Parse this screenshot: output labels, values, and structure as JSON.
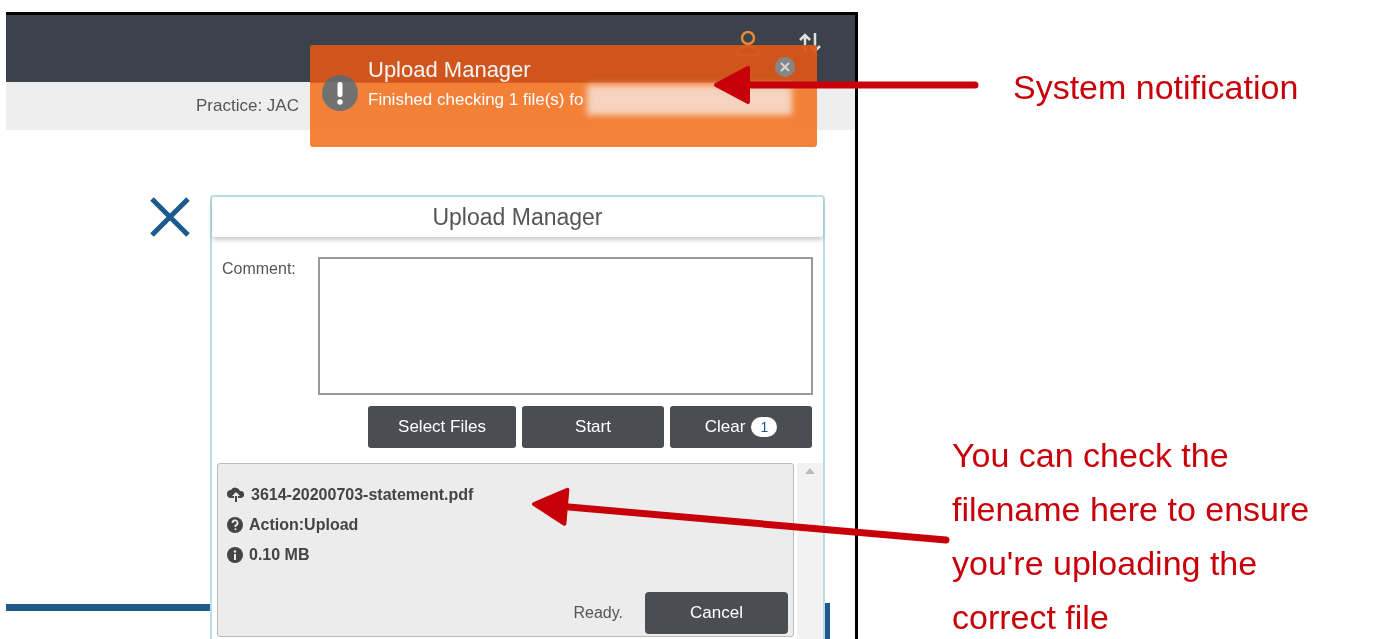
{
  "practice_label": "Practice: JAC",
  "notification": {
    "title": "Upload Manager",
    "message": "Finished checking 1 file(s) fo"
  },
  "upload_manager": {
    "title": "Upload Manager",
    "comment_label": "Comment:",
    "buttons": [
      {
        "label": "Select Files"
      },
      {
        "label": "Start"
      },
      {
        "label": "Clear",
        "badge": "1"
      }
    ],
    "files": [
      {
        "name": "3614-20200703-statement.pdf",
        "action": "Action:Upload",
        "size": "0.10 MB",
        "status": "Ready.",
        "cancel_label": "Cancel"
      }
    ]
  },
  "annotations": [
    {
      "lines": [
        "System notification"
      ]
    },
    {
      "lines": [
        "You can check the",
        "filename here to ensure",
        "you're uploading the",
        "correct file"
      ]
    }
  ]
}
